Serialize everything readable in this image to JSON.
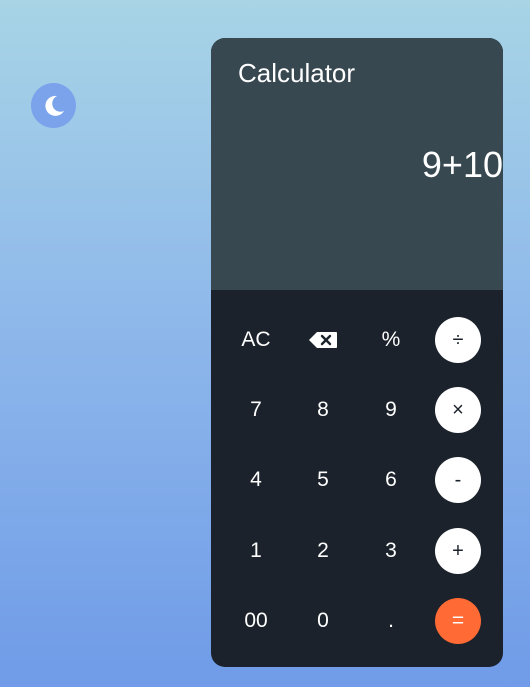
{
  "theme_toggle": {
    "icon": "moon-icon"
  },
  "calculator": {
    "title": "Calculator",
    "expression": "9+10"
  },
  "keys": {
    "clear": "AC",
    "backspace_icon": "backspace-icon",
    "percent": "%",
    "divide": "÷",
    "seven": "7",
    "eight": "8",
    "nine": "9",
    "multiply": "×",
    "four": "4",
    "five": "5",
    "six": "6",
    "subtract": "-",
    "one": "1",
    "two": "2",
    "three": "3",
    "add": "+",
    "double_zero": "00",
    "zero": "0",
    "decimal": ".",
    "equals": "="
  },
  "colors": {
    "display_bg": "#374850",
    "keypad_bg": "#1b222b",
    "operator_bg": "#ffffff",
    "equals_bg": "#ff6a35",
    "toggle_bg": "#7aa3ec"
  }
}
